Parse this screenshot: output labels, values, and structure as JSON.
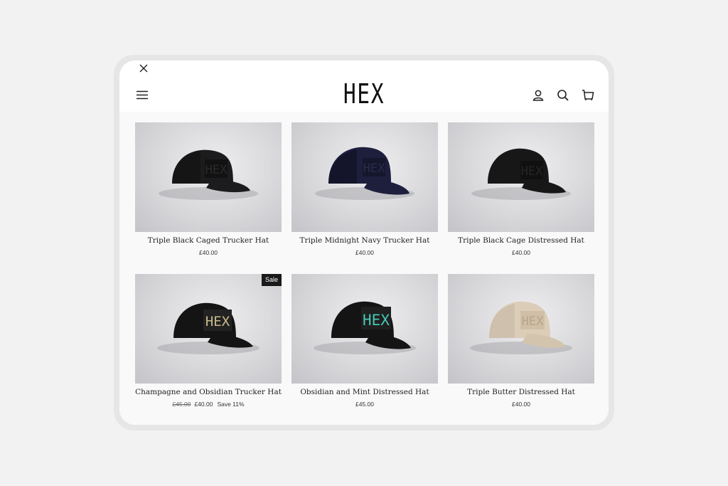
{
  "header": {
    "logo": "HEX",
    "icons": [
      "close-icon",
      "menu-icon",
      "account-icon",
      "search-icon",
      "cart-icon"
    ]
  },
  "products": [
    {
      "title": "Triple Black Caged Trucker Hat",
      "price": "£40.00",
      "cap_color": "#1c1c1e",
      "patch_text_color": "#2a2a2a"
    },
    {
      "title": "Triple Midnight Navy Trucker Hat",
      "price": "£40.00",
      "cap_color": "#1d1f3d",
      "patch_text_color": "#2a2c4a"
    },
    {
      "title": "Triple Black Cage Distressed Hat",
      "price": "£40.00",
      "cap_color": "#171717",
      "patch_text_color": "#262626"
    },
    {
      "title": "Champagne and Obsidian Trucker Hat",
      "badge": "Sale",
      "compare_price": "£45.00",
      "price": "£40.00",
      "save": "Save 11%",
      "cap_color": "#141414",
      "patch_text_color": "#c9b98a"
    },
    {
      "title": "Obsidian and Mint Distressed Hat",
      "price": "£45.00",
      "cap_color": "#141414",
      "patch_text_color": "#47c6b4"
    },
    {
      "title": "Triple Butter Distressed Hat",
      "price": "£40.00",
      "cap_color": "#dbcdb8",
      "patch_text_color": "#b7a48a"
    }
  ]
}
